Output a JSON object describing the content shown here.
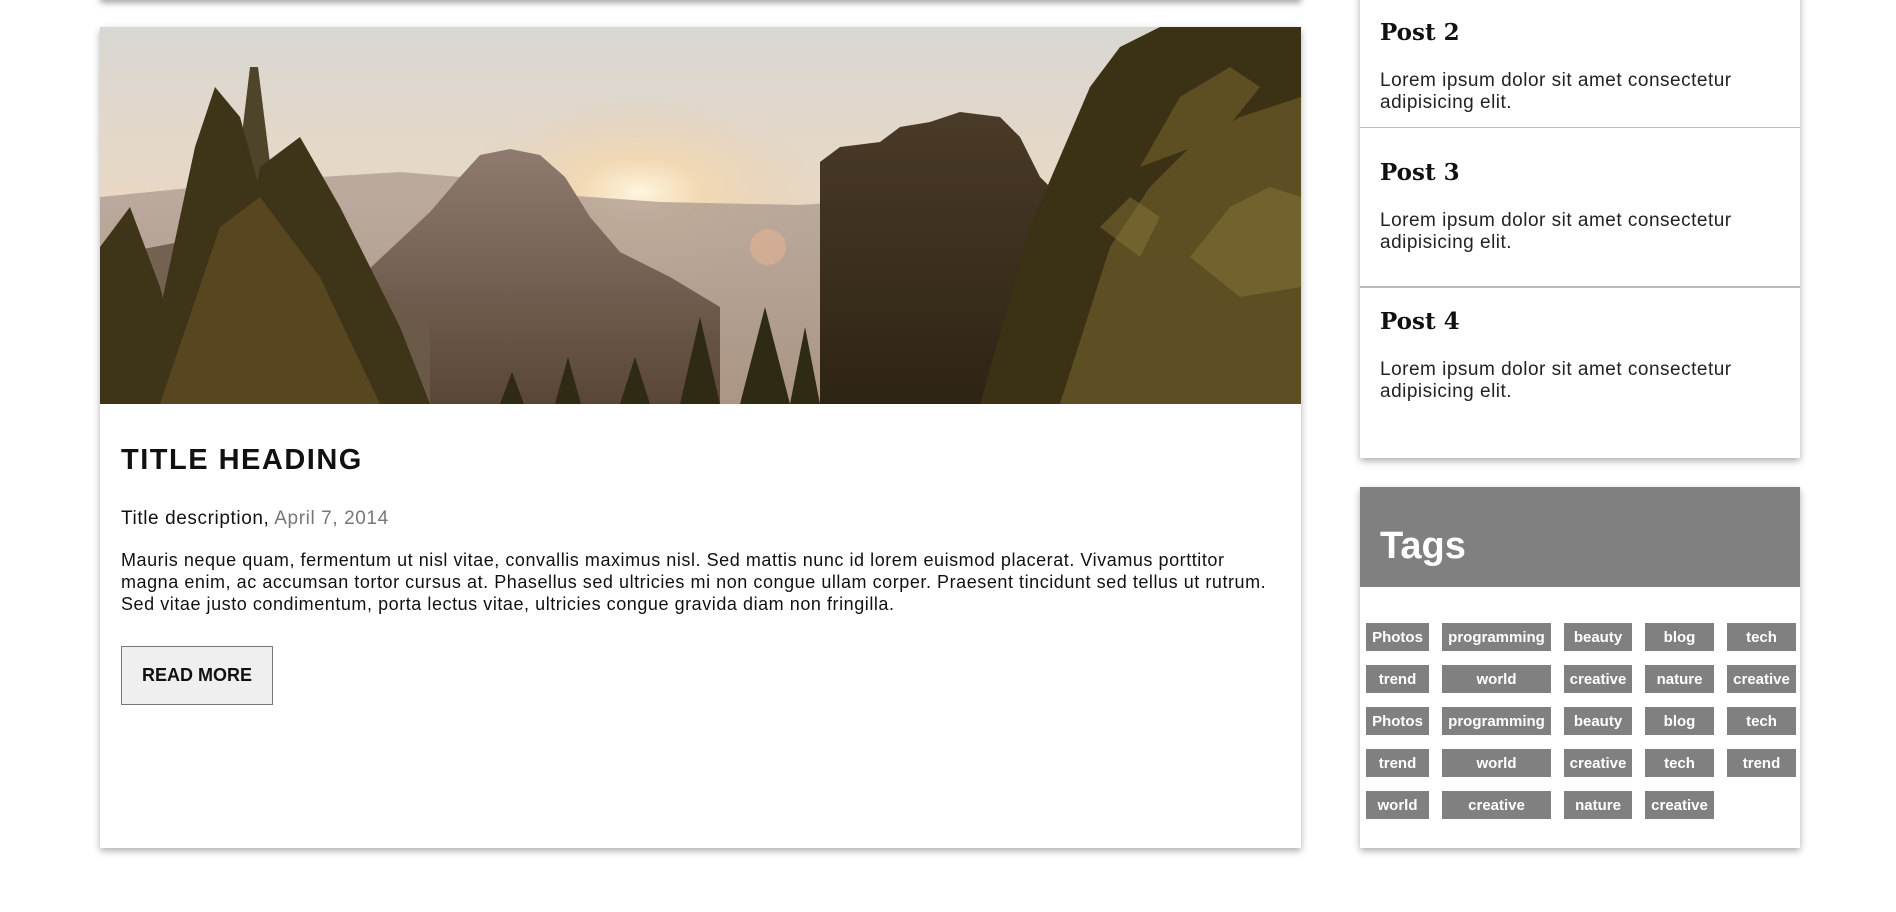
{
  "colors": {
    "tag_bg": "#808080",
    "tags_header_bg": "#808080",
    "date_text": "#777777",
    "button_bg": "#efefef"
  },
  "article": {
    "image_description": "Mountain valley at sunrise framed by pine trees",
    "title": "TITLE HEADING",
    "description_label": "Title description, ",
    "date": "April 7, 2014",
    "body": "Mauris neque quam, fermentum ut nisl vitae, convallis maximus nisl. Sed mattis nunc id lorem euismod placerat. Vivamus porttitor magna enim, ac accumsan tortor cursus at. Phasellus sed ultricies mi non congue ullam corper. Praesent tincidunt sed tellus ut rutrum. Sed vitae justo condimentum, porta lectus vitae, ultricies congue gravida diam non fringilla.",
    "read_more_label": "READ MORE"
  },
  "sidebar": {
    "posts": [
      {
        "title": "Post 2",
        "text": "Lorem ipsum dolor sit amet consectetur adipisicing elit."
      },
      {
        "title": "Post 3",
        "text": "Lorem ipsum dolor sit amet consectetur adipisicing elit."
      },
      {
        "title": "Post 4",
        "text": "Lorem ipsum dolor sit amet consectetur adipisicing elit."
      }
    ],
    "tags_heading": "Tags",
    "tags": [
      "Photos",
      "programming",
      "beauty",
      "blog",
      "tech",
      "trend",
      "world",
      "creative",
      "nature",
      "creative",
      "Photos",
      "programming",
      "beauty",
      "blog",
      "tech",
      "trend",
      "world",
      "creative",
      "tech",
      "trend",
      "world",
      "creative",
      "nature",
      "creative"
    ]
  }
}
